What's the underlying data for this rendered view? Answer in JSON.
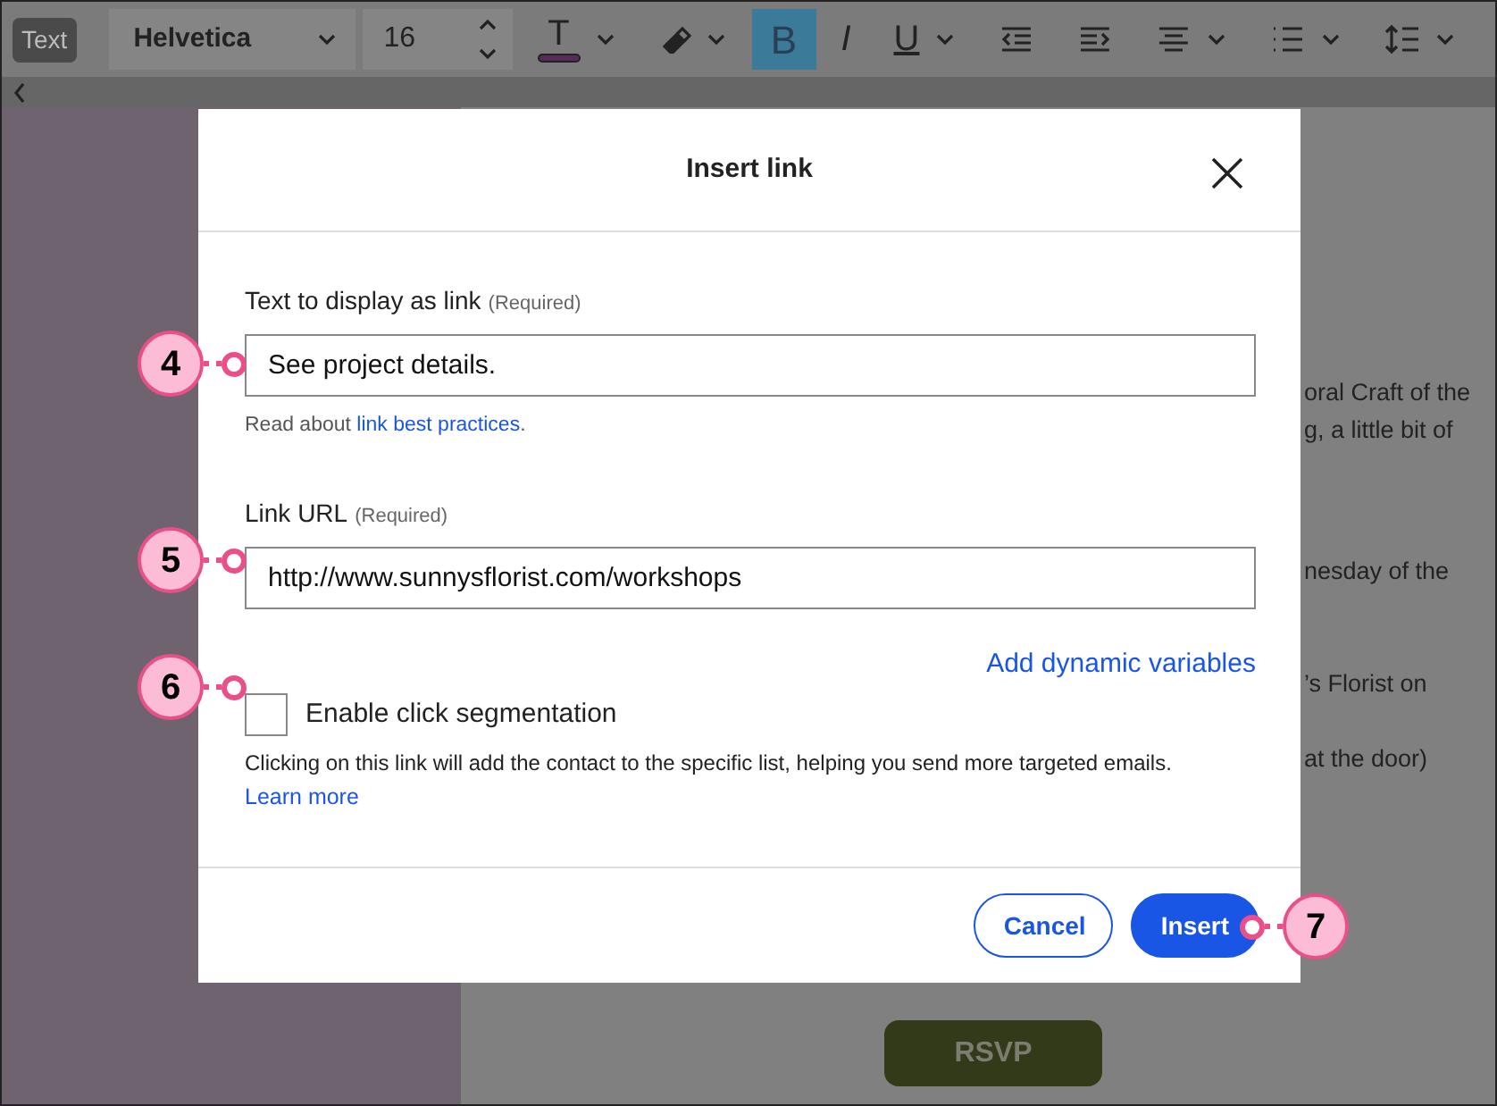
{
  "toolbar": {
    "style_badge": "Text",
    "font": "Helvetica",
    "size": "16",
    "tools": [
      {
        "kind": "text-color",
        "label": "T",
        "dropdown": true
      },
      {
        "kind": "highlight",
        "dropdown": true
      },
      {
        "kind": "format",
        "label": "B",
        "selected": true
      },
      {
        "kind": "format",
        "label": "I",
        "selected": false
      },
      {
        "kind": "format",
        "label": "U",
        "selected": false,
        "dropdown": true
      },
      {
        "kind": "outdent"
      },
      {
        "kind": "indent"
      },
      {
        "kind": "align",
        "dropdown": true
      },
      {
        "kind": "list",
        "dropdown": true
      },
      {
        "kind": "line-height",
        "dropdown": true
      }
    ]
  },
  "page_text": [
    "oral Craft of the",
    "g, a little bit of",
    "nesday of the",
    "’s Florist on",
    "at the door)"
  ],
  "rsvp_button": "RSVP",
  "dialog": {
    "title": "Insert link",
    "text_field": {
      "label": "Text to display as link",
      "required": "(Required)",
      "value": "See project details."
    },
    "help": {
      "text": "Read about ",
      "link": "link best practices",
      "end": "."
    },
    "url_field": {
      "label": "Link URL",
      "required": "(Required)",
      "value": "http://www.sunnysflorist.com/workshops"
    },
    "dynamic_link": "Add dynamic variables",
    "segmentation": {
      "label": "Enable click segmentation",
      "checked": false,
      "description": "Clicking on this link will add the contact to the specific list, helping you send more targeted emails.",
      "learn_more": "Learn more"
    },
    "buttons": [
      {
        "kind": "secondary",
        "label": "Cancel"
      },
      {
        "kind": "primary",
        "label": "Insert"
      }
    ]
  },
  "callouts": [
    {
      "label": "4"
    },
    {
      "label": "5"
    },
    {
      "label": "6"
    },
    {
      "label": "7"
    }
  ]
}
